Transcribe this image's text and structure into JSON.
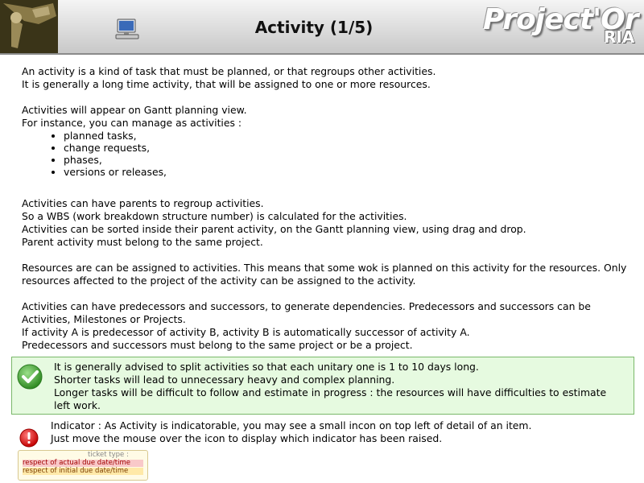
{
  "header": {
    "title": "Activity (1/5)",
    "brand": "Project'Or",
    "brand_sub": "RIA"
  },
  "paragraphs": [
    {
      "lines": [
        "An activity is a kind of task that must be planned, or that regroups other activities.",
        "It is generally a long time activity, that will be assigned to one or more resources."
      ]
    },
    {
      "lines": [
        "Activities will appear on Gantt planning view.",
        "For instance, you can manage as activities :"
      ],
      "bullets": [
        "planned tasks,",
        "change requests,",
        "phases,",
        "versions or releases,"
      ]
    },
    {
      "lines": [
        "Activities can have parents to regroup activities.",
        "So a WBS (work breakdown structure number) is calculated for the activities.",
        "Activities can be sorted inside their parent activity, on the Gantt planning view, using drag and drop.",
        "Parent activity must belong to the same project."
      ]
    },
    {
      "lines": [
        "Resources are can be assigned to activities. This means that some wok is planned on this activity for the resources. Only resources affected to the project of the activity can be assigned to the activity."
      ]
    },
    {
      "lines": [
        "Activities can have predecessors and successors, to generate dependencies. Predecessors and successors can be Activities, Milestones or Projects.",
        "If activity A is predecessor of activity B, activity B is automatically successor of activity A.",
        "Predecessors and successors must belong to the same project or be a project."
      ]
    }
  ],
  "tip": {
    "lines": [
      "It is generally advised to split activities so that each unitary one is 1 to 10 days long.",
      "Shorter tasks will lead to unnecessary heavy and complex planning.",
      "Longer tasks will be difficult to follow and estimate in progress : the resources will have difficulties to estimate left work."
    ]
  },
  "indicator": {
    "lines": [
      "Indicator : As Activity is indicatorable, you may see a small incon on top left of detail of an item.",
      "Just move the mouse over the icon to display which indicator has been raised."
    ],
    "tooltip": {
      "faded": "ticket type :",
      "line1": "respect of actual due date/time",
      "line2": "respect of initial due date/time"
    }
  },
  "colors": {
    "tip_bg": "#e6fae0",
    "tip_border": "#7ab86a",
    "alert_red": "#d81818",
    "check_green": "#3aa02a"
  },
  "icons": [
    "camera-logo-icon",
    "computer-icon",
    "check-icon",
    "alert-icon"
  ]
}
